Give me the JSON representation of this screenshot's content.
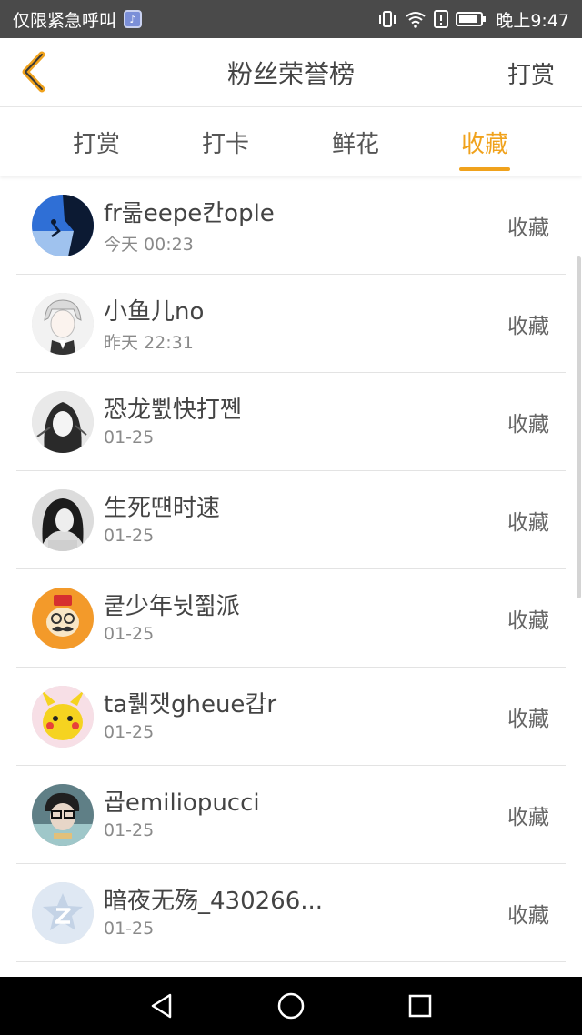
{
  "status_bar": {
    "left_text": "仅限紧急呼叫",
    "time": "晚上9:47",
    "icons": [
      "music-app-icon",
      "vibrate-icon",
      "wifi-icon",
      "alert-icon",
      "battery-icon"
    ]
  },
  "nav": {
    "title": "粉丝荣誉榜",
    "action_label": "打赏",
    "back_icon": "chevron-left-icon"
  },
  "tabs": [
    {
      "label": "打赏",
      "active": false
    },
    {
      "label": "打卡",
      "active": false
    },
    {
      "label": "鲜花",
      "active": false
    },
    {
      "label": "收藏",
      "active": true
    }
  ],
  "accent_color": "#f0a21c",
  "rows": [
    {
      "name": "fr룲eepe칸ople",
      "date": "今天 00:23",
      "action": "收藏",
      "avatar": "climber-silhouette-avatar"
    },
    {
      "name": "小鱼儿no",
      "date": "昨天 22:31",
      "action": "收藏",
      "avatar": "anime-boy-avatar"
    },
    {
      "name": "恐龙쀬快打쪤",
      "date": "01-25",
      "action": "收藏",
      "avatar": "sketch-girl-avatar"
    },
    {
      "name": "生死떈时速",
      "date": "01-25",
      "action": "收藏",
      "avatar": "dark-hair-avatar"
    },
    {
      "name": "쿹少年뉫쬚派",
      "date": "01-25",
      "action": "收藏",
      "avatar": "mustache-monkey-avatar"
    },
    {
      "name": "ta뤩잿gheue캅r",
      "date": "01-25",
      "action": "收藏",
      "avatar": "pikachu-avatar"
    },
    {
      "name": "굡emiliopucci",
      "date": "01-25",
      "action": "收藏",
      "avatar": "glasses-person-avatar"
    },
    {
      "name": "暗夜无殇_430266...",
      "date": "01-25",
      "action": "收藏",
      "avatar": "qzone-default-avatar"
    }
  ],
  "system_nav": [
    "back-triangle-icon",
    "home-circle-icon",
    "recents-square-icon"
  ]
}
